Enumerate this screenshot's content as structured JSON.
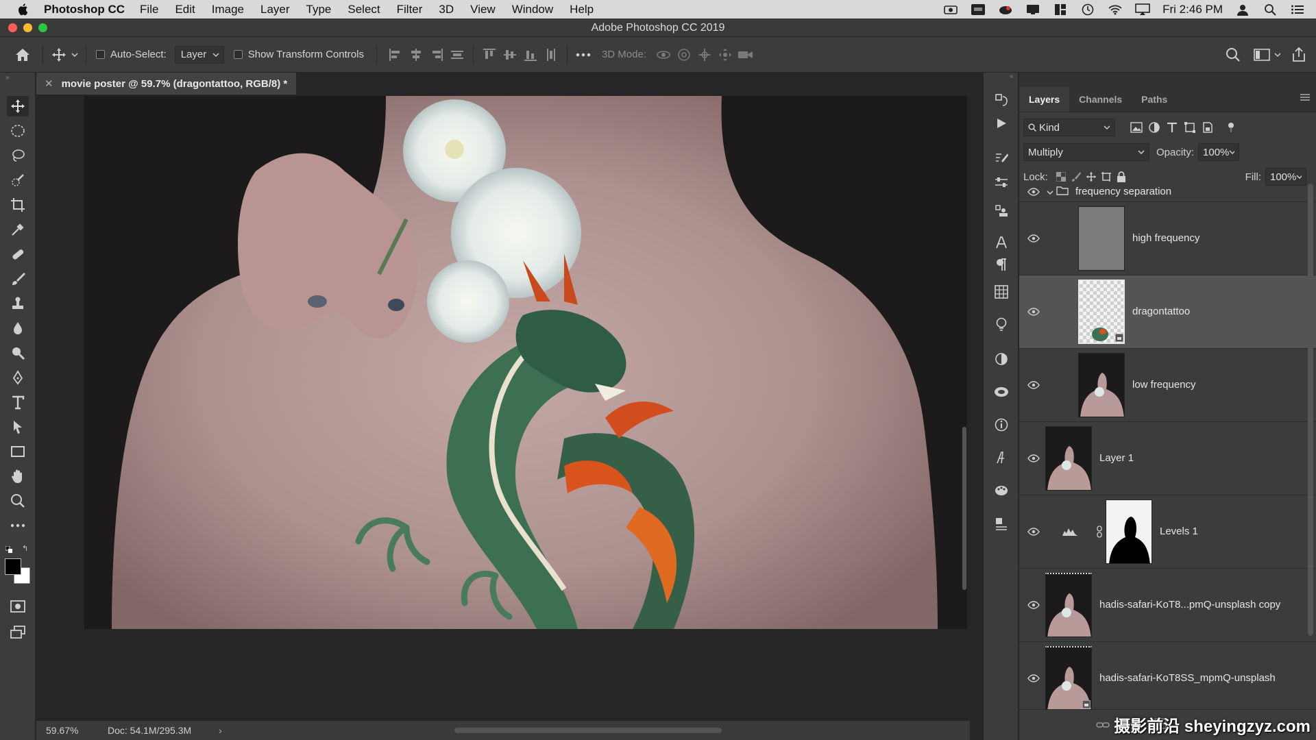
{
  "menubar": {
    "app_name": "Photoshop CC",
    "items": [
      "File",
      "Edit",
      "Image",
      "Layer",
      "Type",
      "Select",
      "Filter",
      "3D",
      "View",
      "Window",
      "Help"
    ],
    "clock": "Fri 2:46 PM",
    "bg": "#d9d9d9"
  },
  "window": {
    "title": "Adobe Photoshop CC 2019"
  },
  "options": {
    "auto_select_label": "Auto-Select:",
    "auto_select_value": "Layer",
    "show_transform_label": "Show Transform Controls",
    "mode_3d_label": "3D Mode:"
  },
  "document": {
    "tab_title": "movie poster @ 59.7% (dragontattoo, RGB/8) *",
    "zoom": "59.67%",
    "doc_size": "Doc: 54.1M/295.3M"
  },
  "panel": {
    "tabs": [
      {
        "label": "Layers",
        "active": true
      },
      {
        "label": "Channels",
        "active": false
      },
      {
        "label": "Paths",
        "active": false
      }
    ],
    "filter_label": "Kind",
    "blend_mode": "Multiply",
    "opacity_label": "Opacity:",
    "opacity": "100%",
    "lock_label": "Lock:",
    "fill_label": "Fill:",
    "fill": "100%"
  },
  "layers": [
    {
      "name": "frequency separation",
      "kind": "group",
      "visible": true
    },
    {
      "name": "high frequency",
      "kind": "gray",
      "visible": true,
      "indent": true
    },
    {
      "name": "dragontattoo",
      "kind": "smart",
      "visible": true,
      "indent": true,
      "selected": true
    },
    {
      "name": "low frequency",
      "kind": "photo",
      "visible": true,
      "indent": true
    },
    {
      "name": "Layer 1",
      "kind": "photo",
      "visible": true
    },
    {
      "name": "Levels 1",
      "kind": "adjustment",
      "visible": true
    },
    {
      "name": "hadis-safari-KoT8...pmQ-unsplash copy",
      "kind": "photo",
      "visible": true
    },
    {
      "name": "hadis-safari-KoT8SS_mpmQ-unsplash",
      "kind": "photo",
      "visible": true
    }
  ],
  "watermark": "摄影前沿 sheyingzyz.com",
  "colors": {
    "app_bg": "#262626",
    "panel_bg": "#3c3c3c",
    "selected_row": "#545454",
    "skin": "#b79a98",
    "tattoo_green": "#3d6f52",
    "tattoo_orange": "#d9531c"
  }
}
